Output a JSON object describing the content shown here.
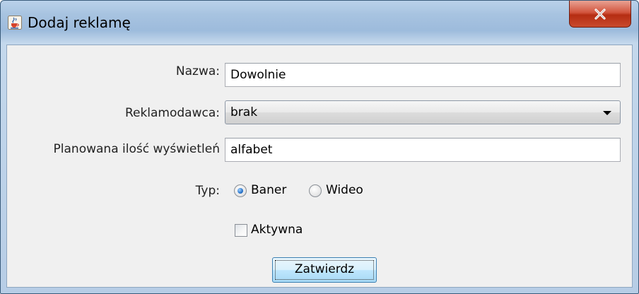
{
  "window": {
    "title": "Dodaj reklamę",
    "close_glyph": "x"
  },
  "form": {
    "name_label": "Nazwa:",
    "name_value": "Dowolnie",
    "advertiser_label": "Reklamodawca:",
    "advertiser_selected": "brak",
    "planned_label": "Planowana ilość wyświetleń",
    "planned_value": "alfabet",
    "type_label": "Typ:",
    "type_options": [
      {
        "label": "Baner",
        "selected": true
      },
      {
        "label": "Wideo",
        "selected": false
      }
    ],
    "active_label": "Aktywna",
    "active_checked": false,
    "submit_label": "Zatwierdz"
  },
  "colors": {
    "title_bar": "#a7c3e0",
    "close_button": "#c94a2d",
    "client_bg": "#f0f0f0",
    "button_accent": "#3c7fb1"
  },
  "icons": {
    "app": "java-cup-icon",
    "close": "close-icon",
    "dropdown": "chevron-down-icon"
  }
}
